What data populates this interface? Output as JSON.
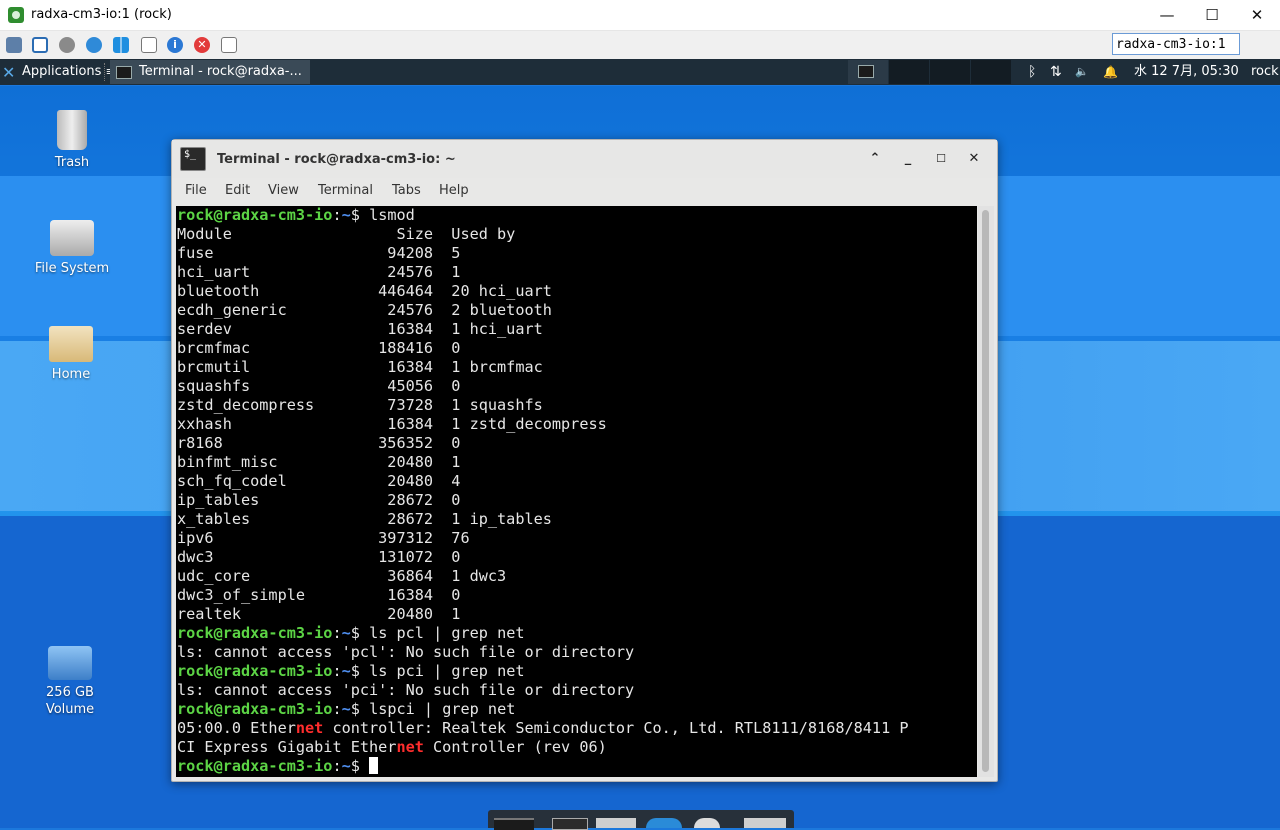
{
  "vnc": {
    "title": "radxa-cm3-io:1 (rock)",
    "controls": {
      "minimize": "—",
      "maximize": "☐",
      "close": "✕"
    },
    "host_field": "radxa-cm3-io:1",
    "toolbar_icons": [
      "options-icon",
      "fullscreen-icon",
      "settings-icon",
      "refresh-icon",
      "windows-key-icon",
      "save-icon",
      "info-icon",
      "disconnect-icon",
      "transfer-icon"
    ]
  },
  "panel": {
    "applications": "Applications",
    "applications_glyph": "≡",
    "task_terminal": "Terminal - rock@radxa-...",
    "clock": "水 12  7月, 05:30",
    "user": "rock",
    "tray": {
      "bluetooth": "ᛒ",
      "network": "⇅",
      "volume": "🔈",
      "bell": "🔔"
    }
  },
  "desktop": {
    "icons": [
      {
        "label": "Trash"
      },
      {
        "label": "File System"
      },
      {
        "label": "Home"
      },
      {
        "label": "256 GB Volume",
        "label_line1": "256 GB",
        "label_line2": "Volume"
      }
    ]
  },
  "terminal": {
    "title": "Terminal - rock@radxa-cm3-io: ~",
    "icon_text": "$_",
    "menu": [
      "File",
      "Edit",
      "View",
      "Terminal",
      "Tabs",
      "Help"
    ],
    "prompt": {
      "user_host": "rock@radxa-cm3-io",
      "sep": ":",
      "path": "~",
      "sym": "$ "
    },
    "commands": {
      "c1": "lsmod",
      "c2": "ls pcl | grep net",
      "c3": "ls pci | grep net",
      "c4": "lspci | grep net"
    },
    "lsmod_header": "Module                  Size  Used by",
    "lsmod_rows": [
      "fuse                   94208  5",
      "hci_uart               24576  1",
      "bluetooth             446464  20 hci_uart",
      "ecdh_generic           24576  2 bluetooth",
      "serdev                 16384  1 hci_uart",
      "brcmfmac              188416  0",
      "brcmutil               16384  1 brcmfmac",
      "squashfs               45056  0",
      "zstd_decompress        73728  1 squashfs",
      "xxhash                 16384  1 zstd_decompress",
      "r8168                 356352  0",
      "binfmt_misc            20480  1",
      "sch_fq_codel           20480  4",
      "ip_tables              28672  0",
      "x_tables               28672  1 ip_tables",
      "ipv6                  397312  76",
      "dwc3                  131072  0",
      "udc_core               36864  1 dwc3",
      "dwc3_of_simple         16384  0",
      "realtek                20480  1"
    ],
    "err1": "ls: cannot access 'pcl': No such file or directory",
    "err2": "ls: cannot access 'pci': No such file or directory",
    "pci_line1": {
      "a": "05:00.0 Ether",
      "hl": "net",
      "b": " controller: Realtek Semiconductor Co., Ltd. RTL8111/8168/8411 P"
    },
    "pci_line2": {
      "a": "CI Express Gigabit Ether",
      "hl": "net",
      "b": " Controller (rev 06)"
    }
  }
}
